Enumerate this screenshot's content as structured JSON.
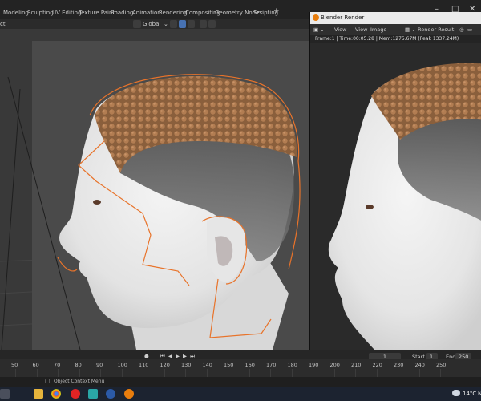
{
  "workspace_tabs": [
    "Modeling",
    "Sculpting",
    "UV Editing",
    "Texture Paint",
    "Shading",
    "Animation",
    "Rendering",
    "Compositing",
    "Geometry Nodes",
    "Scripting"
  ],
  "add_tab": "+",
  "window_controls": {
    "minimize": "–",
    "maximize": "□",
    "close": "✕"
  },
  "viewport_header": {
    "object_mode_fragment": "ct",
    "transform_orientation": "Global"
  },
  "render_window": {
    "title": "Blender Render",
    "menus": [
      "View",
      "View",
      "Image"
    ],
    "image_name": "Render Result",
    "info": "Frame:1 | Time:00:05.28 | Mem:1275.67M (Peak 1337.24M)"
  },
  "timeline": {
    "current_frame": "1",
    "start_label": "Start",
    "start_value": "1",
    "end_label": "End",
    "end_value": "250",
    "ruler_ticks": [
      "50",
      "60",
      "70",
      "80",
      "90",
      "100",
      "110",
      "120",
      "130",
      "140",
      "150",
      "160",
      "170",
      "180",
      "190",
      "200",
      "210",
      "220",
      "230",
      "240",
      "250"
    ]
  },
  "status_bar": {
    "text": "Object Context Menu"
  },
  "taskbar": {
    "weather": "14°C",
    "overflow": "N"
  },
  "colors": {
    "accent_blue": "#4772b3",
    "selection_orange": "#e8732a",
    "blender_orange": "#e87d0d",
    "hair_brown": "#9a6a45"
  }
}
